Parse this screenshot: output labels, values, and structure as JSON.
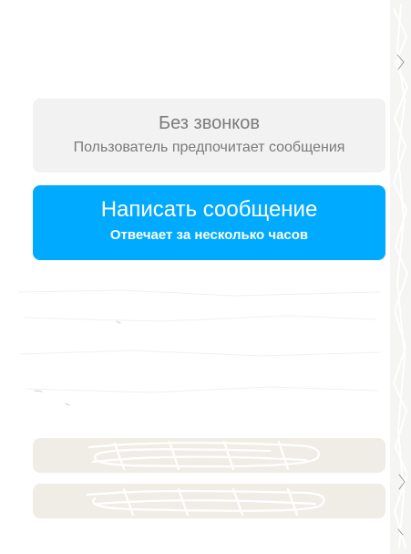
{
  "contact": {
    "no_calls": {
      "title": "Без звонков",
      "subtitle": "Пользователь предпочитает сообщения"
    },
    "write_button": {
      "label": "Написать сообщение",
      "response_time": "Отвечает за несколько часов"
    }
  },
  "colors": {
    "accent": "#00aaff",
    "no_calls_background": "#f2f2f2",
    "hidden_button_background": "#f0ede6"
  }
}
